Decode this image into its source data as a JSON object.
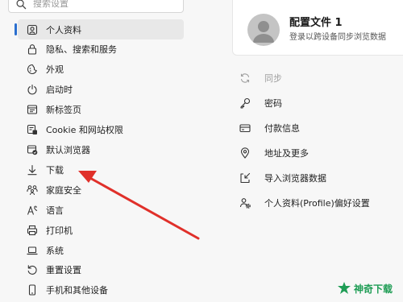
{
  "search": {
    "placeholder": "搜索设置",
    "icon": "search-icon"
  },
  "sidebar": {
    "active_index": 0,
    "accent": "#2b6fcf",
    "items": [
      {
        "label": "个人资料",
        "icon": "profile-icon"
      },
      {
        "label": "隐私、搜索和服务",
        "icon": "lock-icon"
      },
      {
        "label": "外观",
        "icon": "appearance-icon"
      },
      {
        "label": "启动时",
        "icon": "power-icon"
      },
      {
        "label": "新标签页",
        "icon": "new-tab-icon"
      },
      {
        "label": "Cookie 和网站权限",
        "icon": "site-permissions-icon"
      },
      {
        "label": "默认浏览器",
        "icon": "default-browser-icon"
      },
      {
        "label": "下载",
        "icon": "download-icon"
      },
      {
        "label": "家庭安全",
        "icon": "family-icon"
      },
      {
        "label": "语言",
        "icon": "language-icon"
      },
      {
        "label": "打印机",
        "icon": "printer-icon"
      },
      {
        "label": "系统",
        "icon": "laptop-icon"
      },
      {
        "label": "重置设置",
        "icon": "reset-icon"
      },
      {
        "label": "手机和其他设备",
        "icon": "phone-icon"
      }
    ]
  },
  "profile": {
    "name": "配置文件 1",
    "subtitle": "登录以跨设备同步浏览数据",
    "icon": "avatar-icon"
  },
  "options": [
    {
      "label": "同步",
      "icon": "sync-icon",
      "disabled": true
    },
    {
      "label": "密码",
      "icon": "key-icon",
      "disabled": false
    },
    {
      "label": "付款信息",
      "icon": "card-icon",
      "disabled": false
    },
    {
      "label": "地址及更多",
      "icon": "location-icon",
      "disabled": false
    },
    {
      "label": "导入浏览器数据",
      "icon": "import-icon",
      "disabled": false
    },
    {
      "label": "个人资料(Profile)偏好设置",
      "icon": "profile-prefs-icon",
      "disabled": false
    }
  ],
  "annotation": {
    "arrow_color": "#e0302a"
  },
  "watermark": {
    "text": "神奇下载",
    "color": "#1f9d55"
  }
}
